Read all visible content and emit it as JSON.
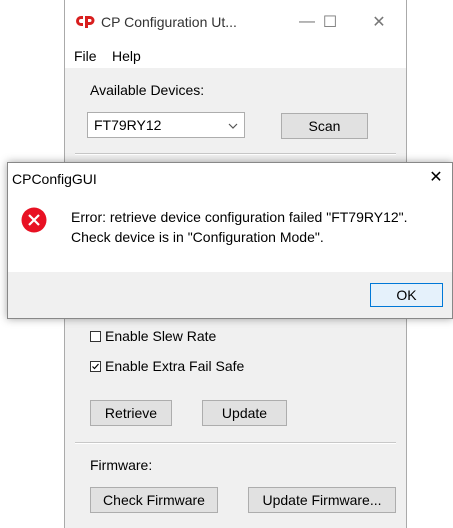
{
  "main_window": {
    "title": "CP Configuration Ut...",
    "logo_icon": "cp-logo-icon",
    "controls": {
      "minimize": "—",
      "maximize": "☐",
      "close": "✕"
    },
    "menu": [
      "File",
      "Help"
    ],
    "available_devices_label": "Available Devices:",
    "device_select": {
      "value": "FT79RY12"
    },
    "scan_label": "Scan",
    "checkboxes": [
      {
        "label": "Enable Slew Rate",
        "checked": false
      },
      {
        "label": "Enable Extra Fail Safe",
        "checked": true
      }
    ],
    "retrieve_label": "Retrieve",
    "update_label": "Update",
    "firmware_label": "Firmware:",
    "check_firmware_label": "Check Firmware",
    "update_firmware_label": "Update Firmware..."
  },
  "dialog": {
    "title": "CPConfigGUI",
    "close_glyph": "✕",
    "icon": "error-icon",
    "message_line1": "Error: retrieve device configuration failed \"FT79RY12\".",
    "message_line2": "Check device is in \"Configuration Mode\".",
    "ok_label": "OK"
  },
  "colors": {
    "error_red": "#e81123",
    "logo_red": "#d81e1e",
    "ok_border": "#0078d7"
  }
}
